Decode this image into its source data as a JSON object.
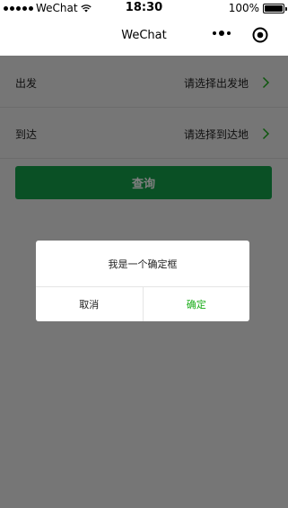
{
  "status_bar": {
    "carrier": "WeChat",
    "time": "18:30",
    "battery": "100%"
  },
  "nav": {
    "title": "WeChat"
  },
  "form": {
    "depart_label": "出发",
    "depart_value": "请选择出发地",
    "arrive_label": "到达",
    "arrive_value": "请选择到达地",
    "query_label": "查询"
  },
  "dialog": {
    "content": "我是一个确定框",
    "cancel_label": "取消",
    "confirm_label": "确定"
  },
  "colors": {
    "primary_green": "#14a04b",
    "confirm_text": "#1aad19",
    "mask": "rgba(0,0,0,0.5)"
  }
}
